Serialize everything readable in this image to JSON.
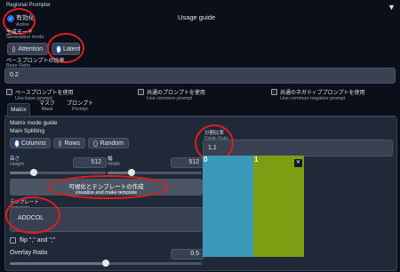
{
  "header": {
    "title": "Regional Prompter",
    "usage_guide": "Usage guide",
    "collapse_glyph": "▼"
  },
  "active": {
    "label_jp": "有効化",
    "label_en": "Active",
    "checked": true
  },
  "generation_mode": {
    "label_jp": "生成モード",
    "label_en": "Generation mode",
    "options": [
      "Attention",
      "Latent"
    ],
    "selected": "Latent"
  },
  "base_ratio": {
    "label_jp": "ベースプロンプトの比率",
    "label_en": "Base Ratio",
    "value": "0.2"
  },
  "checkboxes": [
    {
      "jp": "ベースプロンプトを使用",
      "en": "Use base prompt"
    },
    {
      "jp": "共通のプロンプトを使用",
      "en": "Use common prompt"
    },
    {
      "jp": "共通のネガティブプロンプトを使用",
      "en": "Use common negative prompt"
    }
  ],
  "tabs": [
    {
      "jp": "",
      "en": "Matrix",
      "active": true
    },
    {
      "jp": "マスク",
      "en": "Mask",
      "active": false
    },
    {
      "jp": "プロンプト",
      "en": "Prompt",
      "active": false
    }
  ],
  "matrix": {
    "guide": "Matrix mode guide",
    "main_splitting": "Main Splitting",
    "split_options": [
      "Columns",
      "Rows",
      "Random"
    ],
    "split_selected": "Columns",
    "height": {
      "jp": "高さ",
      "en": "Height",
      "value": "512"
    },
    "width": {
      "jp": "幅",
      "en": "Width",
      "value": "512"
    },
    "divide_ratio": {
      "jp": "分割比率",
      "en": "Divide Ratio",
      "value": "1,1"
    },
    "button": {
      "jp": "可視化とテンプレートの作成",
      "en": "visualize and make template"
    },
    "template": {
      "jp": "テンプレート",
      "en": "Template",
      "value": "ADDCOL"
    },
    "flip": {
      "label": "flip \",\" and \";\""
    },
    "overlay": {
      "label": "Overlay Ratio",
      "value": "0.5",
      "level": 0.5
    }
  },
  "preview": {
    "regions": [
      {
        "label": "0",
        "color": "#3a98b9"
      },
      {
        "label": "1",
        "color": "#7f9d12"
      }
    ],
    "close_glyph": "✕"
  },
  "colors": {
    "accent": "#2563eb",
    "annotation": "#e11d1d"
  }
}
